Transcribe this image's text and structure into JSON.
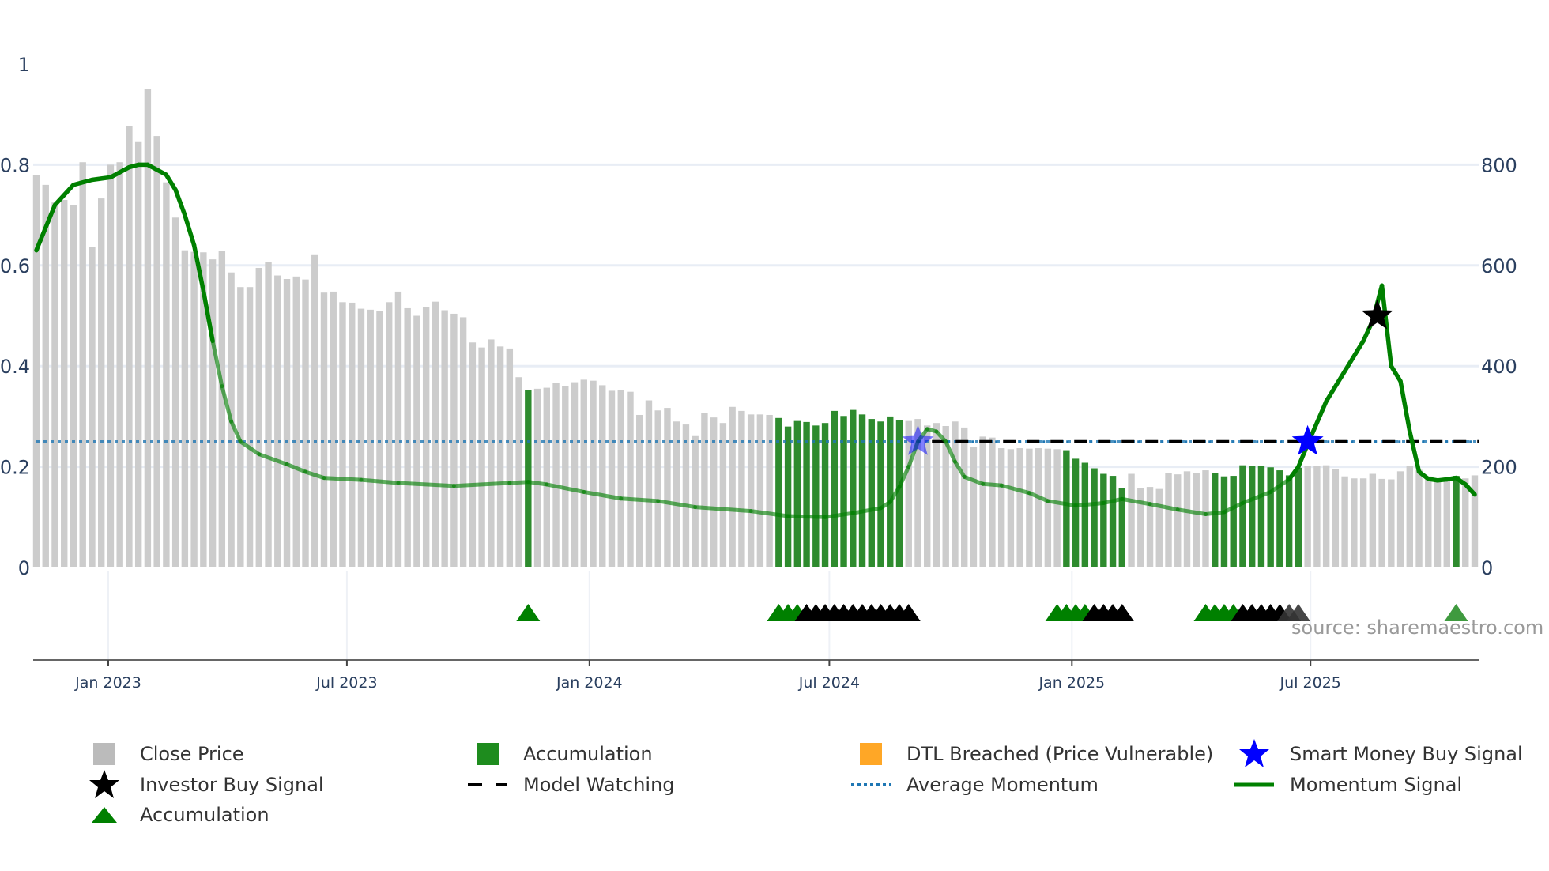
{
  "chart_data": {
    "type": "bar",
    "title": "",
    "start_week": "2022-11-07",
    "frequency": "weekly",
    "x_ticks": [
      "Jan 2023",
      "Jul 2023",
      "Jan 2024",
      "Jul 2024",
      "Jan 2025",
      "Jul 2025"
    ],
    "y_left_ticks": [
      "0",
      "0.2",
      "0.4",
      "0.6",
      "0.8",
      "1"
    ],
    "y_right_ticks": [
      "0",
      "200",
      "400",
      "600",
      "800"
    ],
    "y_left_range": [
      0,
      1
    ],
    "y_right_range": [
      0,
      1000
    ],
    "grid": true,
    "legend_position": "bottom",
    "close_price": [
      780,
      760,
      725,
      730,
      720,
      805,
      636,
      733,
      800,
      805,
      877,
      845,
      950,
      857,
      765,
      695,
      630,
      627,
      626,
      612,
      628,
      586,
      557,
      557,
      595,
      607,
      580,
      573,
      578,
      572,
      622,
      546,
      548,
      527,
      526,
      514,
      512,
      509,
      527,
      548,
      515,
      500,
      518,
      528,
      511,
      504,
      497,
      447,
      437,
      453,
      439,
      435,
      378,
      353,
      355,
      357,
      366,
      360,
      368,
      373,
      371,
      362,
      351,
      352,
      349,
      303,
      332,
      312,
      317,
      290,
      284,
      261,
      307,
      298,
      287,
      319,
      311,
      304,
      304,
      303,
      297,
      280,
      291,
      289,
      282,
      287,
      311,
      301,
      313,
      304,
      295,
      290,
      300,
      292,
      291,
      295,
      282,
      287,
      281,
      290,
      278,
      240,
      260,
      258,
      237,
      235,
      237,
      236,
      237,
      236,
      235,
      233,
      216,
      208,
      197,
      186,
      182,
      158,
      186,
      158,
      160,
      156,
      187,
      185,
      191,
      188,
      193,
      188,
      181,
      182,
      203,
      201,
      201,
      199,
      193,
      183,
      198,
      201,
      202,
      203,
      195,
      181,
      177,
      177,
      186,
      176,
      175,
      191,
      201,
      194,
      181,
      176,
      178,
      182,
      177,
      183
    ],
    "accumulation_weeks": [
      54,
      81,
      82,
      83,
      84,
      85,
      86,
      87,
      88,
      89,
      90,
      91,
      92,
      93,
      94,
      112,
      113,
      114,
      115,
      116,
      117,
      118,
      128,
      129,
      130,
      131,
      132,
      133,
      134,
      135,
      136,
      137,
      154
    ],
    "momentum_signal": [
      [
        1,
        0.63
      ],
      [
        3,
        0.72
      ],
      [
        5,
        0.76
      ],
      [
        7,
        0.77
      ],
      [
        9,
        0.775
      ],
      [
        11,
        0.795
      ],
      [
        12,
        0.8
      ],
      [
        13,
        0.8
      ],
      [
        15,
        0.78
      ],
      [
        16,
        0.75
      ],
      [
        17,
        0.7
      ],
      [
        18,
        0.64
      ],
      [
        19,
        0.55
      ],
      [
        20,
        0.45
      ],
      [
        21,
        0.36
      ],
      [
        22,
        0.29
      ],
      [
        23,
        0.25
      ],
      [
        25,
        0.225
      ],
      [
        28,
        0.205
      ],
      [
        30,
        0.19
      ],
      [
        32,
        0.178
      ],
      [
        36,
        0.174
      ],
      [
        40,
        0.168
      ],
      [
        46,
        0.162
      ],
      [
        52,
        0.168
      ],
      [
        54,
        0.17
      ],
      [
        56,
        0.165
      ],
      [
        60,
        0.15
      ],
      [
        64,
        0.137
      ],
      [
        68,
        0.132
      ],
      [
        72,
        0.12
      ],
      [
        78,
        0.112
      ],
      [
        82,
        0.102
      ],
      [
        86,
        0.1
      ],
      [
        89,
        0.108
      ],
      [
        92,
        0.118
      ],
      [
        93,
        0.13
      ],
      [
        94,
        0.16
      ],
      [
        95,
        0.2
      ],
      [
        96,
        0.25
      ],
      [
        97,
        0.275
      ],
      [
        98,
        0.27
      ],
      [
        99,
        0.25
      ],
      [
        100,
        0.21
      ],
      [
        101,
        0.18
      ],
      [
        103,
        0.166
      ],
      [
        105,
        0.163
      ],
      [
        108,
        0.148
      ],
      [
        110,
        0.132
      ],
      [
        113,
        0.123
      ],
      [
        116,
        0.128
      ],
      [
        118,
        0.136
      ],
      [
        121,
        0.126
      ],
      [
        124,
        0.115
      ],
      [
        127,
        0.106
      ],
      [
        129,
        0.11
      ],
      [
        131,
        0.128
      ],
      [
        134,
        0.15
      ],
      [
        136,
        0.175
      ],
      [
        137,
        0.2
      ],
      [
        138,
        0.245
      ],
      [
        140,
        0.33
      ],
      [
        142,
        0.39
      ],
      [
        144,
        0.45
      ],
      [
        145,
        0.49
      ],
      [
        146,
        0.56
      ],
      [
        147,
        0.4
      ],
      [
        148,
        0.37
      ],
      [
        149,
        0.27
      ],
      [
        150,
        0.19
      ],
      [
        151,
        0.176
      ],
      [
        152,
        0.173
      ],
      [
        153,
        0.175
      ],
      [
        154,
        0.178
      ],
      [
        155,
        0.165
      ],
      [
        156,
        0.145
      ]
    ],
    "strong_momentum_ranges": [
      [
        1,
        20
      ],
      [
        136,
        156
      ]
    ],
    "average_momentum": 0.25,
    "model_watching": {
      "from_week": 97,
      "to_week": 156,
      "value": 0.25
    },
    "smart_money_buy_signals": [
      {
        "week": 96,
        "value": 0.25,
        "faded": true
      },
      {
        "week": 138,
        "value": 0.25,
        "faded": false
      }
    ],
    "investor_buy_signals": [
      {
        "week": 145.5,
        "value": 0.5
      }
    ],
    "accumulation_markers_green": [
      54,
      81,
      82,
      83,
      111,
      112,
      113,
      114,
      127,
      128,
      129,
      130
    ],
    "accumulation_markers_black": [
      84,
      85,
      86,
      87,
      88,
      89,
      90,
      91,
      92,
      93,
      94,
      95,
      115,
      116,
      117,
      118,
      131,
      132,
      133,
      134,
      135
    ],
    "accumulation_markers_gray": [
      136,
      137
    ],
    "accumulation_markers_light": [
      154
    ],
    "colors": {
      "close": "#cccccc",
      "accumulation": "#2e8b2e",
      "momentum": "#008000",
      "average": "#1f77b4",
      "dtl": "#ffa500",
      "smart_money": "#0000ff",
      "investor": "#000000",
      "grid": "#e8edf5"
    }
  },
  "legend": [
    {
      "label": "Close Price",
      "icon": "gray-square"
    },
    {
      "label": "Accumulation",
      "icon": "green-square"
    },
    {
      "label": "DTL Breached (Price Vulnerable)",
      "icon": "orange-square"
    },
    {
      "label": "Smart Money Buy Signal",
      "icon": "blue-star"
    },
    {
      "label": "Investor Buy Signal",
      "icon": "black-star"
    },
    {
      "label": "Model Watching",
      "icon": "black-dash"
    },
    {
      "label": "Average Momentum",
      "icon": "blue-dots"
    },
    {
      "label": "Momentum Signal",
      "icon": "green-line"
    },
    {
      "label": "Accumulation",
      "icon": "green-triangle"
    }
  ],
  "source": "source: sharemaestro.com"
}
